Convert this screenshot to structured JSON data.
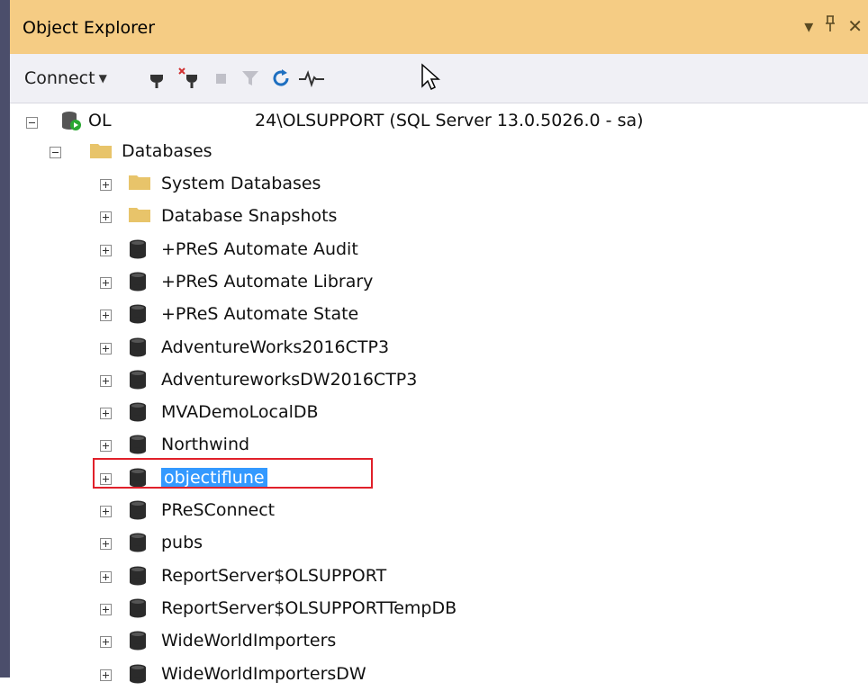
{
  "panel": {
    "title": "Object Explorer",
    "pin_icon": "pin-icon",
    "dropdown_icon": "chevron-down-icon",
    "close_icon": "close-icon"
  },
  "toolbar": {
    "connect_label": "Connect",
    "icons": [
      "connect-icon",
      "disconnect-icon",
      "stop-icon",
      "filter-icon",
      "refresh-icon",
      "activity-monitor-icon"
    ]
  },
  "tree": {
    "server": {
      "label_prefix": "OL",
      "label_suffix": "24\\OLSUPPORT (SQL Server 13.0.5026.0 - sa)"
    },
    "databases_label": "Databases",
    "folders": [
      {
        "label": "System Databases"
      },
      {
        "label": "Database Snapshots"
      }
    ],
    "databases": [
      {
        "label": "+PReS Automate Audit"
      },
      {
        "label": "+PReS Automate Library"
      },
      {
        "label": "+PReS Automate State"
      },
      {
        "label": "AdventureWorks2016CTP3"
      },
      {
        "label": "AdventureworksDW2016CTP3"
      },
      {
        "label": "MVADemoLocalDB"
      },
      {
        "label": "Northwind"
      },
      {
        "label": "objectiflune",
        "selected": true
      },
      {
        "label": "PReSConnect"
      },
      {
        "label": "pubs"
      },
      {
        "label": "ReportServer$OLSUPPORT"
      },
      {
        "label": "ReportServer$OLSUPPORTTempDB"
      },
      {
        "label": "WideWorldImporters"
      },
      {
        "label": "WideWorldImportersDW"
      }
    ]
  },
  "colors": {
    "titlebar": "#f5cc84",
    "selection": "#3399ff",
    "highlight_border": "#e0202a"
  }
}
